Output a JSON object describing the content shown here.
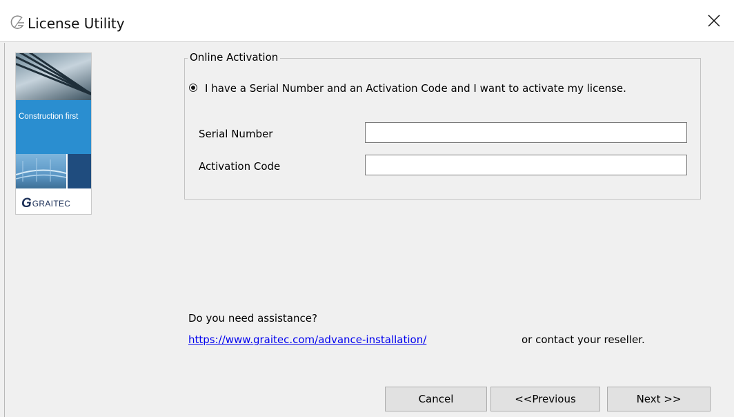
{
  "window": {
    "title": "License Utility",
    "close_glyph": "✕"
  },
  "logo": {
    "tagline": "Construction first",
    "brand_mark": "G",
    "brand_name": "GRAITEC"
  },
  "group": {
    "legend": "Online Activation",
    "radio_label": "I have a Serial Number and an Activation Code and I want to activate my license.",
    "radio_checked": true,
    "fields": [
      {
        "label": "Serial Number",
        "value": "",
        "placeholder": ""
      },
      {
        "label": "Activation Code",
        "value": "",
        "placeholder": ""
      }
    ]
  },
  "assistance": {
    "question": "Do you need assistance?",
    "link": "https://www.graitec.com/advance-installation/",
    "contact": "or contact your reseller."
  },
  "buttons": {
    "cancel": "Cancel",
    "previous": "<<Previous",
    "next": "Next >>"
  },
  "colors": {
    "link": "#0000ee",
    "brand_blue": "#2a8ed0",
    "brand_dark": "#1f4c7e"
  }
}
